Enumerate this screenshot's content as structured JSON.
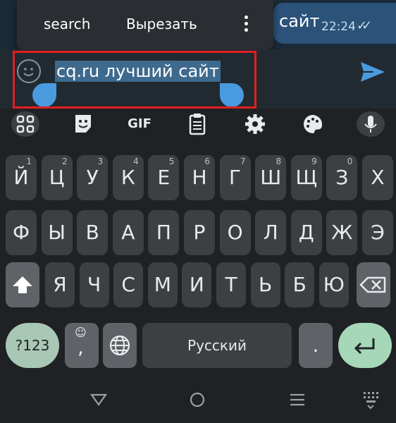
{
  "chat": {
    "bubble_text": "сайт",
    "time": "22:24",
    "checks": "✓✓"
  },
  "context_menu": {
    "items": [
      "search",
      "Вырезать"
    ]
  },
  "input": {
    "text": "cq.ru лучший сайт"
  },
  "keyboard": {
    "toolbar_icons": [
      "apps-grid-icon",
      "sticker-icon",
      "gif-icon",
      "clipboard-icon",
      "settings-icon",
      "palette-icon",
      "microphone-icon"
    ],
    "gif_label": "GIF",
    "row1": [
      {
        "label": "Й",
        "hint": "1"
      },
      {
        "label": "Ц",
        "hint": "2"
      },
      {
        "label": "У",
        "hint": "3"
      },
      {
        "label": "К",
        "hint": "4"
      },
      {
        "label": "Е",
        "hint": "5"
      },
      {
        "label": "Н",
        "hint": "6"
      },
      {
        "label": "Г",
        "hint": "7"
      },
      {
        "label": "Ш",
        "hint": "8"
      },
      {
        "label": "Щ",
        "hint": "9"
      },
      {
        "label": "З",
        "hint": "0"
      },
      {
        "label": "Х",
        "hint": ""
      }
    ],
    "row2": [
      "Ф",
      "Ы",
      "В",
      "А",
      "П",
      "Р",
      "О",
      "Л",
      "Д",
      "Ж",
      "Э"
    ],
    "row3": [
      "Я",
      "Ч",
      "С",
      "М",
      "И",
      "Т",
      "Ь",
      "Б",
      "Ю"
    ],
    "sym_label": "?123",
    "comma_label": ",",
    "space_label": "Русский",
    "period_label": "."
  },
  "navbar": {
    "icons": [
      "back-icon",
      "home-icon",
      "recents-icon",
      "keyboard-switch-icon"
    ]
  },
  "colors": {
    "accent": "#4a9ae0",
    "highlight_box": "#e02020",
    "enter_key": "#a6d8b8"
  }
}
